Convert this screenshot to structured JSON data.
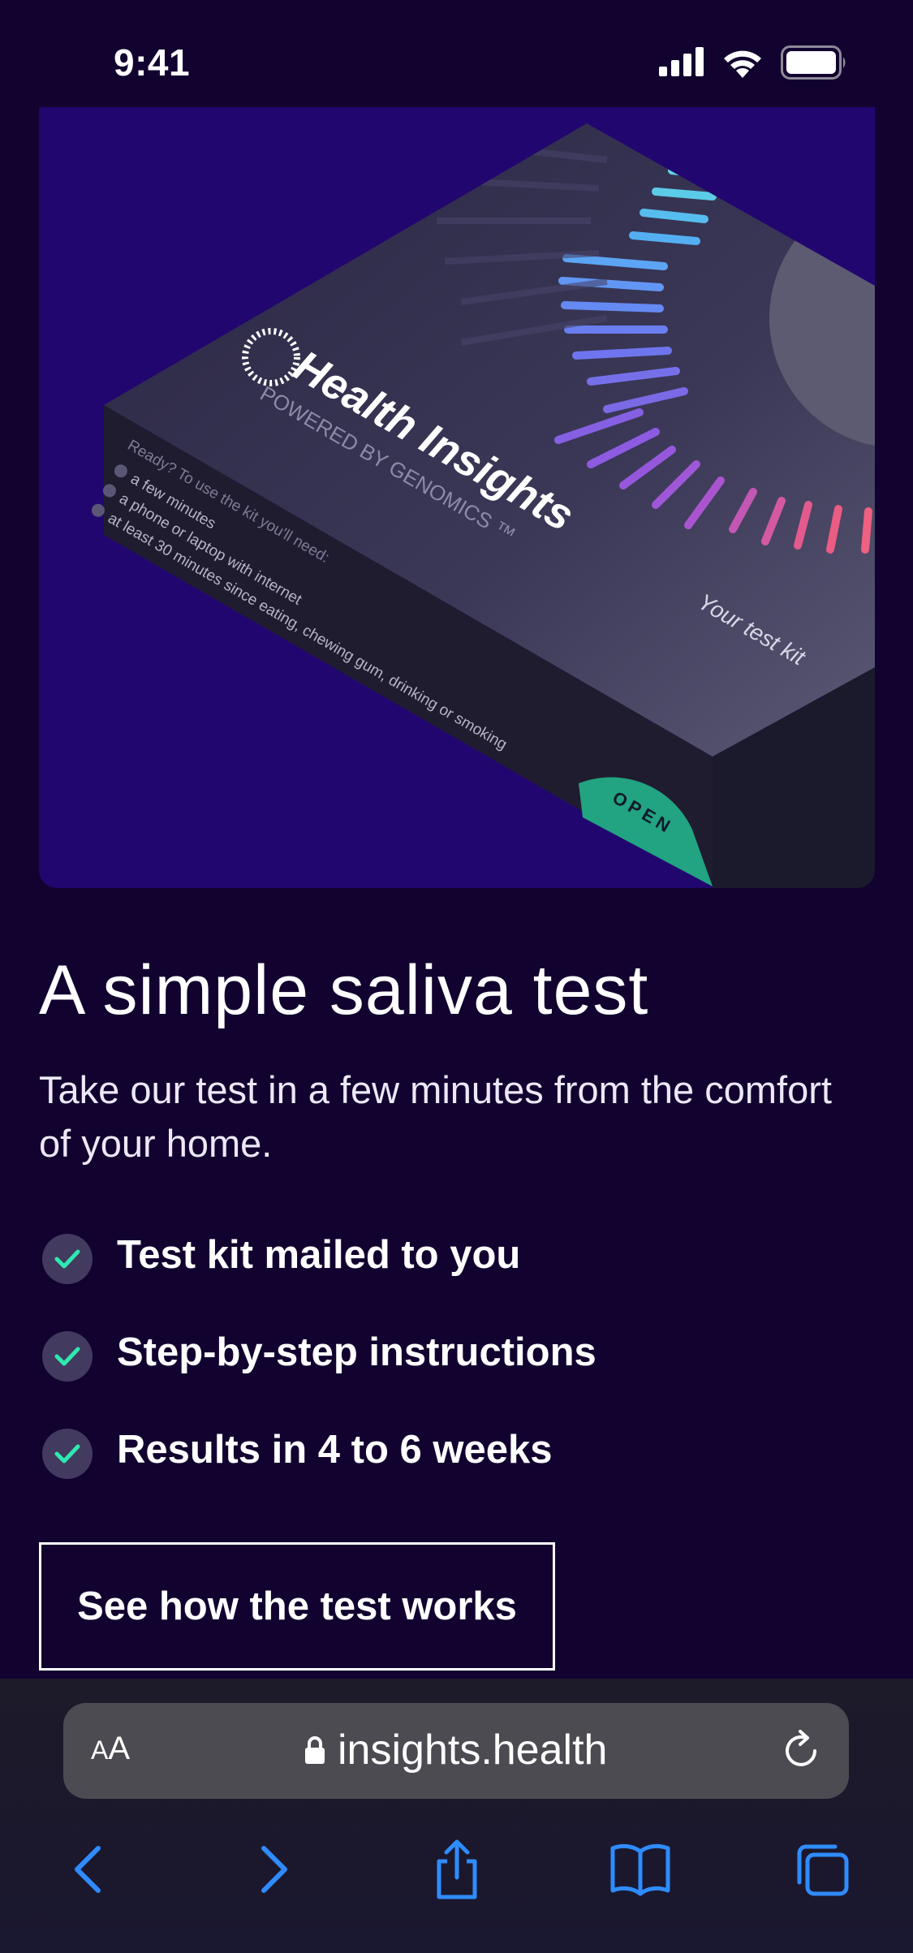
{
  "status": {
    "time": "9:41"
  },
  "hero": {
    "brand": "Health Insights",
    "tagline": "POWERED BY GENOMICS ™",
    "kit_label": "Your test kit",
    "tab_label": "OPEN",
    "requirements_title": "Ready? To use the kit you'll need:",
    "requirements": [
      "a few minutes",
      "a phone or laptop with internet",
      "at least 30 minutes since eating, chewing gum, drinking or smoking"
    ]
  },
  "main": {
    "headline": "A simple saliva test",
    "subtitle": "Take our test in a few minutes from the comfort of your home.",
    "features": [
      "Test kit mailed to you",
      "Step-by-step instructions",
      "Results in 4 to 6 weeks"
    ],
    "cta": "See how the test works"
  },
  "browser": {
    "text_size_small": "A",
    "text_size_large": "A",
    "url": "insights.health",
    "toolbar": [
      "back-icon",
      "forward-icon",
      "share-icon",
      "bookmarks-icon",
      "tabs-icon"
    ]
  },
  "colors": {
    "background": "#12022f",
    "hero_background": "#220670",
    "box_top": "#3a3655",
    "accent_green": "#22a381",
    "check_green": "#2ee8b0",
    "link_blue": "#2f8cff"
  }
}
